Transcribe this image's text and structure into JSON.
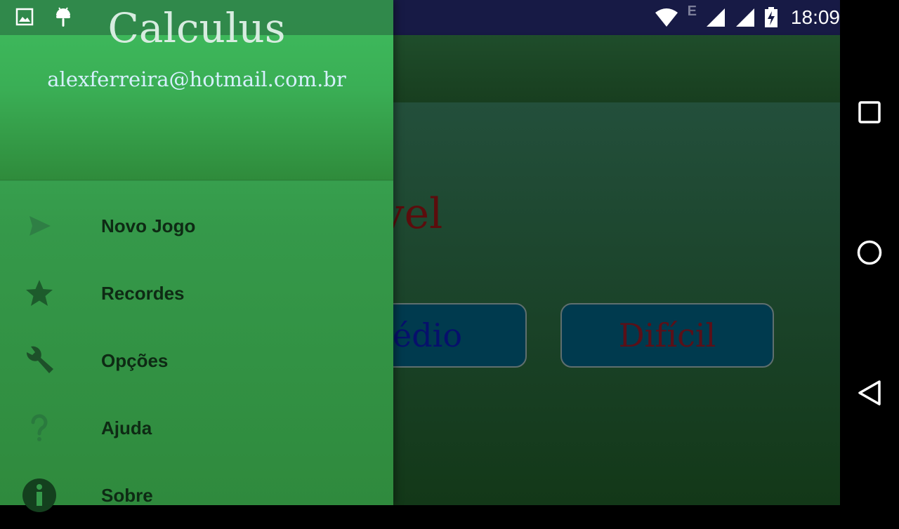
{
  "statusbar": {
    "time": "18:09",
    "network_letter": "E"
  },
  "drawer": {
    "title": "Calculus",
    "email": "alexferreira@hotmail.com.br",
    "menu": [
      {
        "label": "Novo Jogo",
        "icon": "send-icon"
      },
      {
        "label": "Recordes",
        "icon": "star-icon"
      },
      {
        "label": "Opções",
        "icon": "wrench-icon"
      },
      {
        "label": "Ajuda",
        "icon": "question-icon"
      },
      {
        "label": "Sobre",
        "icon": "info-icon"
      }
    ]
  },
  "main": {
    "level_title_visible": "a o Nível",
    "buttons": {
      "medio": "Médio",
      "dificil": "Difícil"
    }
  },
  "colors": {
    "drawer_green": "#3fb75c",
    "statusbar": "#171a45",
    "button_bg": "#003a4e"
  }
}
